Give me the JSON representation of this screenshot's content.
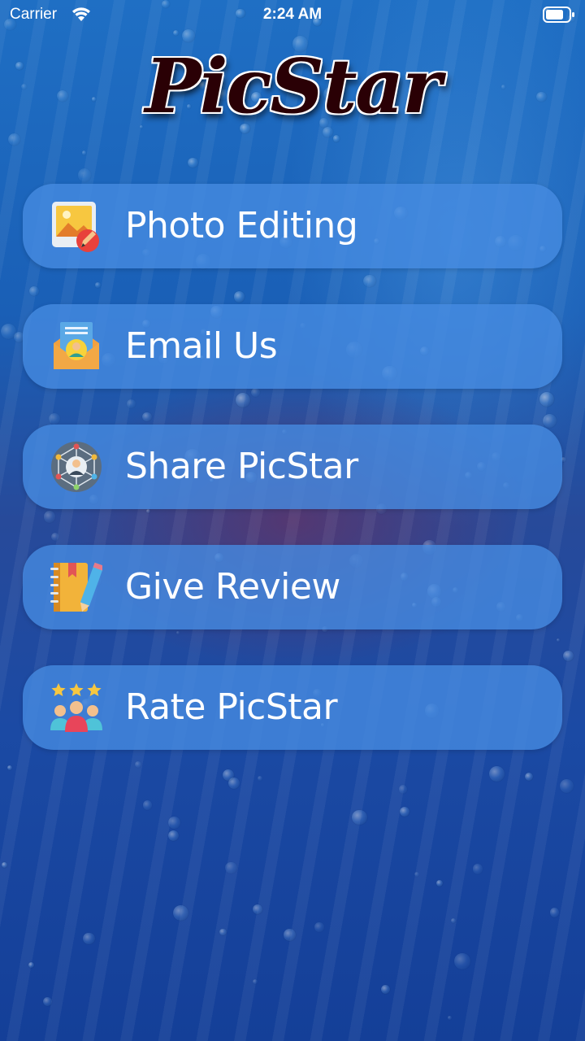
{
  "status_bar": {
    "carrier": "Carrier",
    "time": "2:24 AM",
    "wifi_icon": "wifi-icon",
    "battery_icon": "battery-icon"
  },
  "app": {
    "logo_text": "PicStar"
  },
  "menu": [
    {
      "label": "Photo Editing",
      "icon": "photo-edit-icon"
    },
    {
      "label": "Email Us",
      "icon": "email-icon"
    },
    {
      "label": "Share PicStar",
      "icon": "share-network-icon"
    },
    {
      "label": "Give Review",
      "icon": "notebook-pencil-icon"
    },
    {
      "label": "Rate PicStar",
      "icon": "rating-people-icon"
    }
  ],
  "colors": {
    "background_top": "#1f6fc4",
    "background_bottom": "#143f98",
    "button_fill": "#468ce1",
    "text": "#ffffff"
  }
}
